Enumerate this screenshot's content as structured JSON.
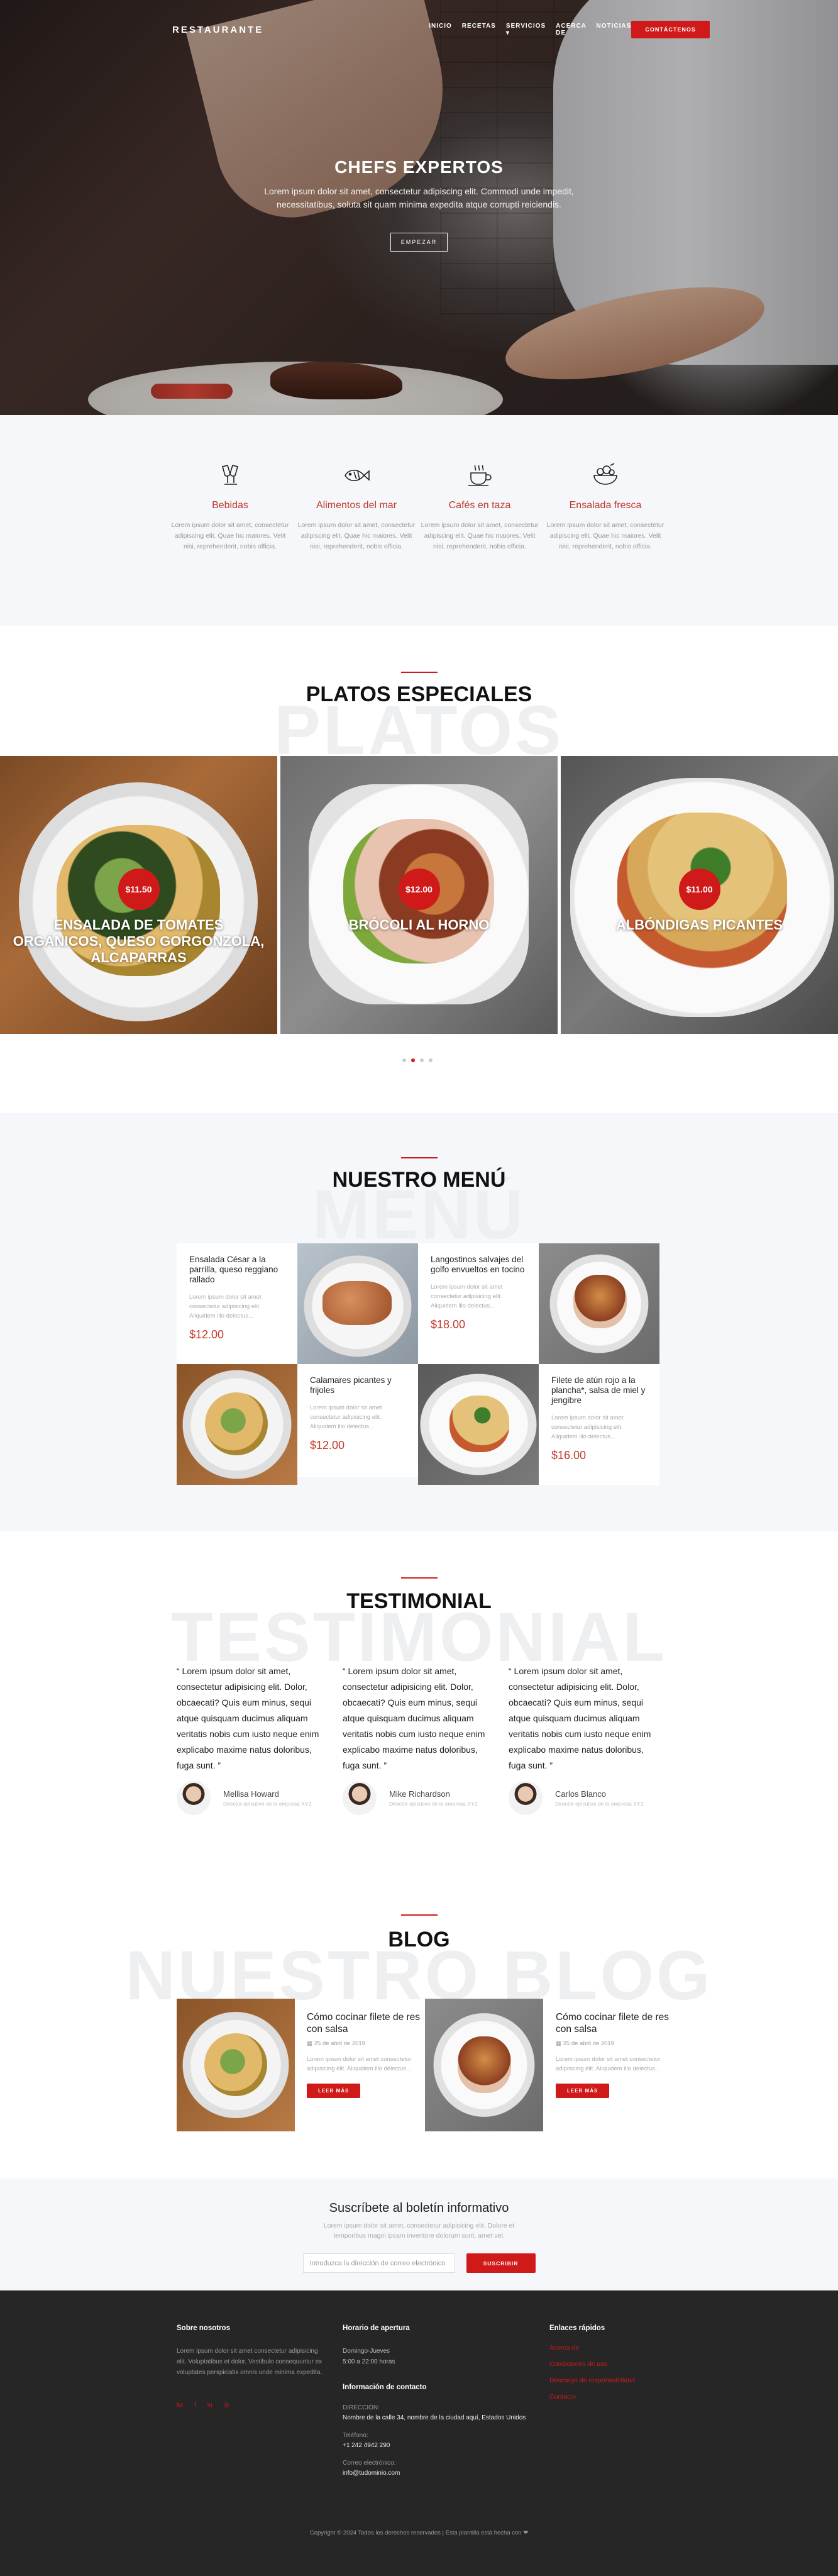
{
  "colors": {
    "accent": "#d01a1a",
    "accent_text": "#c0392b",
    "section_bg": "#f5f7fa",
    "footer_bg": "#262626"
  },
  "nav": {
    "brand": "RESTAURANTE",
    "items": [
      "INICIO",
      "RECETAS",
      "SERVICIOS ▾",
      "ACERCA DE",
      "NOTICIAS"
    ],
    "cta": "CONTÁCTENOS"
  },
  "hero": {
    "title": "CHEFS EXPERTOS",
    "text1": "Lorem ipsum dolor sit amet, consectetur adipiscing elit. Commodi unde impedit,",
    "text2": "necessitatibus, soluta sit quam minima expedita atque corrupti reiciendis.",
    "button": "EMPEZAR"
  },
  "features": [
    {
      "icon": "drinks-icon",
      "title": "Bebidas",
      "text": "Lorem ipsum dolor sit amet, consectetur adipiscing elit. Quae hic maiores. Velit nisi, reprehenderit, nobis officia."
    },
    {
      "icon": "fish-icon",
      "title": "Alimentos del mar",
      "text": "Lorem ipsum dolor sit amet, consectetur adipiscing elit. Quae hic maiores. Velit nisi, reprehenderit, nobis officia."
    },
    {
      "icon": "cup-icon",
      "title": "Cafés en taza",
      "text": "Lorem ipsum dolor sit amet, consectetur adipiscing elit. Quae hic maiores. Velit nisi, reprehenderit, nobis officia."
    },
    {
      "icon": "salad-icon",
      "title": "Ensalada fresca",
      "text": "Lorem ipsum dolor sit amet, consectetur adipiscing elit. Quae hic maiores. Velit nisi, reprehenderit, nobis officia."
    }
  ],
  "specials": {
    "title": "PLATOS ESPECIALES",
    "ghost": "PLATOS",
    "dishes": [
      {
        "price": "$11.50",
        "name": "ENSALADA DE TOMATES ORGÁNICOS, QUESO GORGONZOLA, ALCAPARRAS"
      },
      {
        "price": "$12.00",
        "name": "BRÓCOLI AL HORNO"
      },
      {
        "price": "$11.00",
        "name": "ALBÓNDIGAS PICANTES"
      }
    ]
  },
  "menu": {
    "title": "NUESTRO MENÚ",
    "ghost": "MENÚ",
    "items": [
      {
        "name": "Ensalada César a la parrilla, queso reggiano rallado",
        "desc": "Lorem ipsum dolor sit amet consectetur adipisicing elit. Aliquidem illo delectus...",
        "price": "$12.00"
      },
      {
        "name": "Langostinos salvajes del golfo envueltos en tocino",
        "desc": "Lorem ipsum dolor sit amet consectetur adipisicing elit. Aliquidem illo delectus...",
        "price": "$18.00"
      },
      {
        "name": "Calamares picantes y frijoles",
        "desc": "Lorem ipsum dolor sit amet consectetur adipisicing elit. Aliquidem illo delectus...",
        "price": "$12.00"
      },
      {
        "name": "Filete de atún rojo a la plancha*, salsa de miel y jengibre",
        "desc": "Lorem ipsum dolor sit amet consectetur adipisicing elit. Aliquidem illo delectus...",
        "price": "$16.00"
      }
    ]
  },
  "testimonial": {
    "title": "TESTIMONIAL",
    "ghost": "TESTIMONIAL",
    "items": [
      {
        "quote": "“ Lorem ipsum dolor sit amet, consectetur adipisicing elit. Dolor, obcaecati? Quis eum minus, sequi atque quisquam ducimus aliquam veritatis nobis cum iusto neque enim explicabo maxime natus doloribus, fuga sunt. ”",
        "name": "Mellisa Howard",
        "role": "Director ejecutivo de la empresa XYZ"
      },
      {
        "quote": "“ Lorem ipsum dolor sit amet, consectetur adipisicing elit. Dolor, obcaecati? Quis eum minus, sequi atque quisquam ducimus aliquam veritatis nobis cum iusto neque enim explicabo maxime natus doloribus, fuga sunt. ”",
        "name": "Mike Richardson",
        "role": "Director ejecutivo de la empresa XYZ"
      },
      {
        "quote": "“ Lorem ipsum dolor sit amet, consectetur adipisicing elit. Dolor, obcaecati? Quis eum minus, sequi atque quisquam ducimus aliquam veritatis nobis cum iusto neque enim explicabo maxime natus doloribus, fuga sunt. ”",
        "name": "Carlos Blanco",
        "role": "Director ejecutivo de la empresa XYZ"
      }
    ]
  },
  "blog": {
    "title": "BLOG",
    "ghost": "NUESTRO BLOG",
    "posts": [
      {
        "title": "Cómo cocinar filete de res con salsa",
        "date": "▦ 25 de abril de 2019",
        "desc": "Lorem ipsum dolor sit amet consectetur adipisicing elit. Aliquidem illo delectus...",
        "button": "LEER MÁS"
      },
      {
        "title": "Cómo cocinar filete de res con salsa",
        "date": "▦ 25 de abril de 2019",
        "desc": "Lorem ipsum dolor sit amet consectetur adipisicing elit. Aliquidem illo delectus...",
        "button": "LEER MÁS"
      }
    ]
  },
  "newsletter": {
    "title": "Suscríbete al boletín informativo",
    "text1": "Lorem ipsum dolor sit amet, consectetur adipisicing elit. Dolore et",
    "text2": "temporibus magni ipsam inventore dolorum sunt, amet vel.",
    "placeholder": "Introduzca la dirección de correo electrónico",
    "button": "SUSCRIBIR"
  },
  "footer": {
    "about_title": "Sobre nosotros",
    "about_text": "Lorem ipsum dolor sit amet consectetur adipisicing elit. Voluptatibus et dolor. Vestibulo consequuntur ex voluptates perspiciatis omnis unde minima expedita.",
    "social": [
      "tw",
      "f",
      "in",
      "◎"
    ],
    "hours_title": "Horario de apertura",
    "hours_days": "Domingo-Jueves",
    "hours_time": "5:00 a 22:00 horas",
    "contact_title": "Información de contacto",
    "addr_label": "DIRECCIÓN:",
    "addr": "Nombre de la calle 34, nombre de la ciudad aquí, Estados Unidos",
    "phone_label": "Teléfono:",
    "phone": "+1 242 4942 290",
    "email_label": "Correo electrónico:",
    "email": "info@tudominio.com",
    "links_title": "Enlaces rápidos",
    "links": [
      "Acerca de",
      "Condiciones de uso",
      "Descargo de responsabilidad",
      "Contacto"
    ],
    "copyright": "Copyright © 2024 Todos los derechos reservados | Esta plantilla está hecha con ❤"
  }
}
